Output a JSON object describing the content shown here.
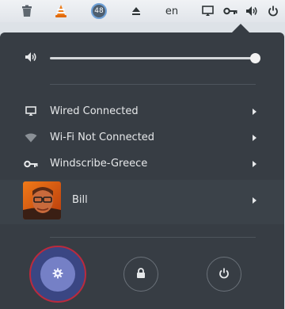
{
  "topbar": {
    "notification_count": "48",
    "language": "en",
    "icons": [
      "trash-icon",
      "vlc-cone-icon",
      "notification-badge",
      "eject-icon",
      "display-icon",
      "vpn-key-icon",
      "volume-icon",
      "power-icon"
    ]
  },
  "menu": {
    "volume": {
      "level": 1.0,
      "icon": "speaker-icon"
    },
    "rows": [
      {
        "label": "Wired Connected",
        "icon": "wired-network-icon"
      },
      {
        "label": "Wi-Fi Not Connected",
        "icon": "wifi-icon"
      },
      {
        "label": "Windscribe-Greece",
        "icon": "vpn-key-icon"
      }
    ],
    "user": {
      "name": "Bill",
      "icon": "avatar"
    },
    "actions": [
      "settings-icon",
      "lock-icon",
      "power-icon"
    ]
  },
  "colors": {
    "menu_bg": "#373d44",
    "topbar_bg": "#e6e9ed",
    "settings_highlight": "#3a4683",
    "settings_ring": "#bb2a3d"
  }
}
